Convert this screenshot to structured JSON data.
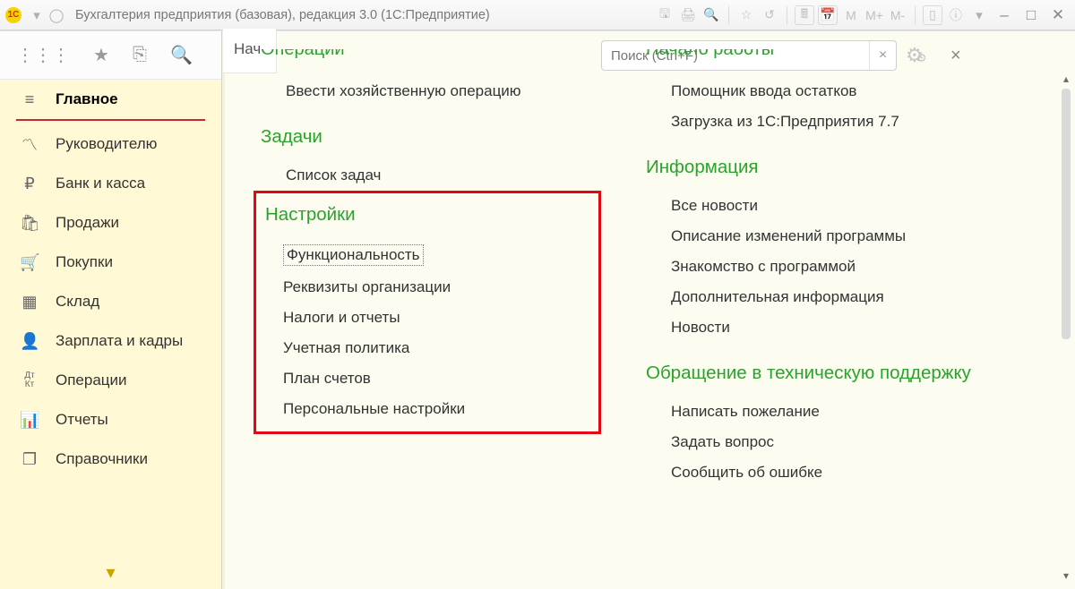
{
  "window": {
    "title": "Бухгалтерия предприятия (базовая), редакция 3.0  (1С:Предприятие)",
    "m_labels": [
      "M",
      "M+",
      "M-"
    ]
  },
  "tab_stub": "Нач",
  "search": {
    "placeholder": "Поиск (Ctrl+F)"
  },
  "sidebar": {
    "items": [
      {
        "label": "Главное"
      },
      {
        "label": "Руководителю"
      },
      {
        "label": "Банк и касса"
      },
      {
        "label": "Продажи"
      },
      {
        "label": "Покупки"
      },
      {
        "label": "Склад"
      },
      {
        "label": "Зарплата и кадры"
      },
      {
        "label": "Операции"
      },
      {
        "label": "Отчеты"
      },
      {
        "label": "Справочники"
      }
    ]
  },
  "left_col": {
    "cutoff_heading": "Операции",
    "cutoff_item": "Ввести хозяйственную операцию",
    "s1_title": "Задачи",
    "s1_items": [
      "Список задач"
    ],
    "s2_title": "Настройки",
    "s2_items": [
      "Функциональность",
      "Реквизиты организации",
      "Налоги и отчеты",
      "Учетная политика",
      "План счетов",
      "Персональные настройки"
    ]
  },
  "right_col": {
    "cutoff_heading": "Начало работы",
    "cutoff_items": [
      "Помощник ввода остатков",
      "Загрузка из 1С:Предприятия 7.7"
    ],
    "s1_title": "Информация",
    "s1_items": [
      "Все новости",
      "Описание изменений программы",
      "Знакомство с программой",
      "Дополнительная информация",
      "Новости"
    ],
    "s2_title": "Обращение в техническую поддержку",
    "s2_items": [
      "Написать пожелание",
      "Задать вопрос",
      "Сообщить об ошибке"
    ]
  }
}
